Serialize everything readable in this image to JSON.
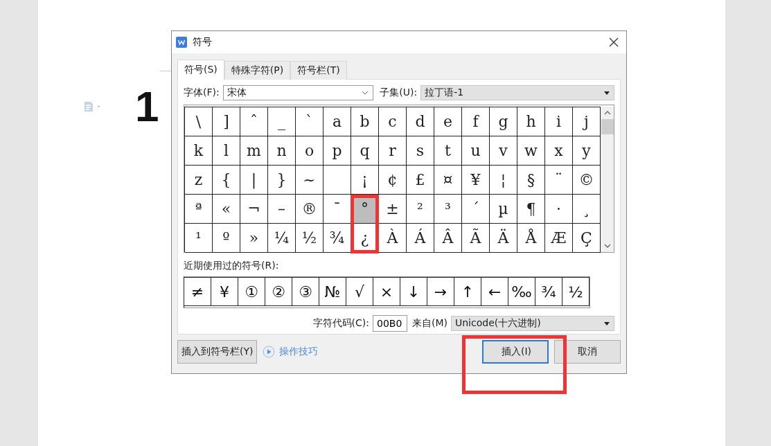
{
  "document": {
    "heading": "1"
  },
  "dialog": {
    "title": "符号",
    "tabs": [
      {
        "label": "符号(S)",
        "selected": true
      },
      {
        "label": "特殊字符(P)",
        "selected": false
      },
      {
        "label": "符号栏(T)",
        "selected": false
      }
    ],
    "font": {
      "label": "字体(F):",
      "value": "宋体"
    },
    "subset": {
      "label": "子集(U):",
      "value": "拉丁语-1"
    },
    "symbol_rows": [
      [
        {
          "symbol": "\\",
          "selected": false
        },
        {
          "symbol": "]",
          "selected": false
        },
        {
          "symbol": "ˆ",
          "selected": false
        },
        {
          "symbol": "_",
          "selected": false
        },
        {
          "symbol": "`",
          "selected": false
        },
        {
          "symbol": "a",
          "selected": false
        },
        {
          "symbol": "b",
          "selected": false
        },
        {
          "symbol": "c",
          "selected": false
        },
        {
          "symbol": "d",
          "selected": false
        },
        {
          "symbol": "e",
          "selected": false
        },
        {
          "symbol": "f",
          "selected": false
        },
        {
          "symbol": "g",
          "selected": false
        },
        {
          "symbol": "h",
          "selected": false
        },
        {
          "symbol": "i",
          "selected": false
        },
        {
          "symbol": "j",
          "selected": false
        }
      ],
      [
        {
          "symbol": "k",
          "selected": false
        },
        {
          "symbol": "l",
          "selected": false
        },
        {
          "symbol": "m",
          "selected": false
        },
        {
          "symbol": "n",
          "selected": false
        },
        {
          "symbol": "o",
          "selected": false
        },
        {
          "symbol": "p",
          "selected": false
        },
        {
          "symbol": "q",
          "selected": false
        },
        {
          "symbol": "r",
          "selected": false
        },
        {
          "symbol": "s",
          "selected": false
        },
        {
          "symbol": "t",
          "selected": false
        },
        {
          "symbol": "u",
          "selected": false
        },
        {
          "symbol": "v",
          "selected": false
        },
        {
          "symbol": "w",
          "selected": false
        },
        {
          "symbol": "x",
          "selected": false
        },
        {
          "symbol": "y",
          "selected": false
        }
      ],
      [
        {
          "symbol": "z",
          "selected": false
        },
        {
          "symbol": "{",
          "selected": false
        },
        {
          "symbol": "|",
          "selected": false
        },
        {
          "symbol": "}",
          "selected": false
        },
        {
          "symbol": "~",
          "selected": false
        },
        {
          "selected": false
        },
        {
          "symbol": "¡",
          "selected": false
        },
        {
          "symbol": "¢",
          "selected": false
        },
        {
          "symbol": "£",
          "selected": false
        },
        {
          "symbol": "¤",
          "selected": false
        },
        {
          "symbol": "¥",
          "selected": false
        },
        {
          "symbol": "¦",
          "selected": false
        },
        {
          "symbol": "§",
          "selected": false
        },
        {
          "symbol": "¨",
          "selected": false
        },
        {
          "symbol": "©",
          "selected": false
        }
      ],
      [
        {
          "symbol": "ª",
          "selected": false
        },
        {
          "symbol": "«",
          "selected": false
        },
        {
          "symbol": "¬",
          "selected": false
        },
        {
          "symbol": "–",
          "selected": false
        },
        {
          "symbol": "®",
          "selected": false
        },
        {
          "symbol": "¯",
          "selected": false
        },
        {
          "symbol": "°",
          "selected": true
        },
        {
          "symbol": "±",
          "selected": false
        },
        {
          "symbol": "²",
          "selected": false
        },
        {
          "symbol": "³",
          "selected": false
        },
        {
          "symbol": "´",
          "selected": false
        },
        {
          "symbol": "µ",
          "selected": false
        },
        {
          "symbol": "¶",
          "selected": false
        },
        {
          "symbol": "·",
          "selected": false
        },
        {
          "symbol": "¸",
          "selected": false
        }
      ],
      [
        {
          "symbol": "¹",
          "selected": false
        },
        {
          "symbol": "º",
          "selected": false
        },
        {
          "symbol": "»",
          "selected": false
        },
        {
          "symbol": "¼",
          "selected": false
        },
        {
          "symbol": "½",
          "selected": false
        },
        {
          "symbol": "¾",
          "selected": false
        },
        {
          "symbol": "¿",
          "selected": false
        },
        {
          "symbol": "À",
          "selected": false
        },
        {
          "symbol": "Á",
          "selected": false
        },
        {
          "symbol": "Â",
          "selected": false
        },
        {
          "symbol": "Ã",
          "selected": false
        },
        {
          "symbol": "Ä",
          "selected": false
        },
        {
          "symbol": "Å",
          "selected": false
        },
        {
          "symbol": "Æ",
          "selected": false
        },
        {
          "symbol": "Ç",
          "selected": false
        }
      ]
    ],
    "recent_label": "近期使用过的符号(R):",
    "recent_symbols": [
      "≠",
      "¥",
      "①",
      "②",
      "③",
      "№",
      "√",
      "×",
      "↓",
      "→",
      "↑",
      "←",
      "‰",
      "¾",
      "½"
    ],
    "char_code": {
      "label": "字符代码(C):",
      "value": "00B0"
    },
    "from": {
      "label": "来自(M)",
      "value": "Unicode(十六进制)"
    },
    "buttons": [
      {
        "kind": "toolbar",
        "label": "插入到符号栏(Y)"
      },
      {
        "kind": "link",
        "label": "操作技巧"
      },
      {
        "kind": "primary",
        "label": "插入(I)"
      },
      {
        "kind": "plain",
        "label": "取消"
      }
    ]
  }
}
